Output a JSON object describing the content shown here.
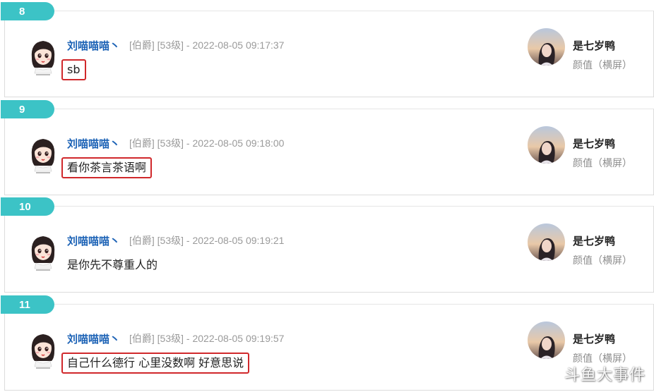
{
  "comments": [
    {
      "index": "8",
      "username": "刘喵喵喵丶",
      "meta": "[伯爵] [53级] - 2022-08-05 09:17:37",
      "message": "sb",
      "boxed": true,
      "host_name": "是七岁鸭",
      "host_category": "颜值（横屏）"
    },
    {
      "index": "9",
      "username": "刘喵喵喵丶",
      "meta": "[伯爵] [53级] - 2022-08-05 09:18:00",
      "message": "看你茶言茶语啊",
      "boxed": true,
      "host_name": "是七岁鸭",
      "host_category": "颜值（横屏）"
    },
    {
      "index": "10",
      "username": "刘喵喵喵丶",
      "meta": "[伯爵] [53级] - 2022-08-05 09:19:21",
      "message": "是你先不尊重人的",
      "boxed": false,
      "host_name": "是七岁鸭",
      "host_category": "颜值（横屏）"
    },
    {
      "index": "11",
      "username": "刘喵喵喵丶",
      "meta": "[伯爵] [53级] - 2022-08-05 09:19:57",
      "message": "自己什么德行 心里没数啊 好意思说",
      "boxed": true,
      "host_name": "是七岁鸭",
      "host_category": "颜值（横屏）"
    }
  ],
  "watermark": "斗鱼大事件",
  "colors": {
    "tab": "#3cc3c6",
    "username": "#1d63b6",
    "highlight_box": "#d0282b"
  },
  "icons": {
    "user_avatar": "cartoon-girl-avatar-icon",
    "host_avatar": "streamer-photo-avatar-icon"
  }
}
